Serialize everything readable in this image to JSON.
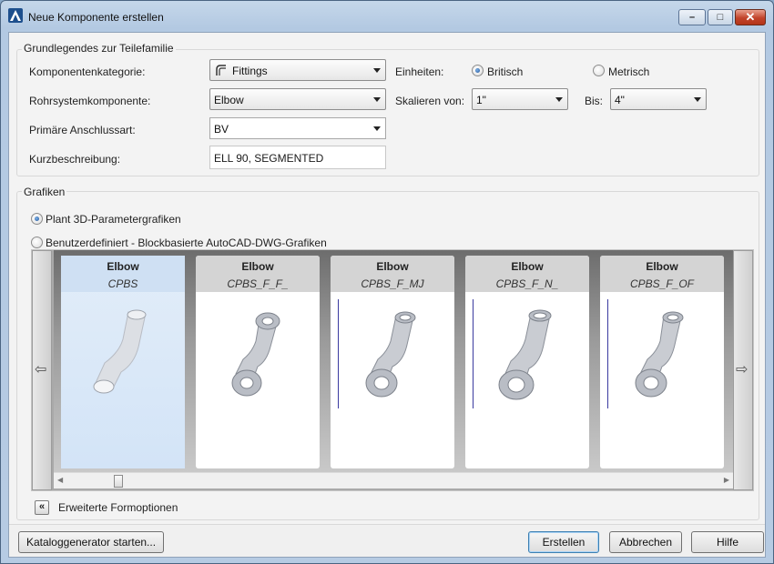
{
  "window": {
    "title": "Neue Komponente erstellen"
  },
  "basics": {
    "legend": "Grundlegendes zur Teilefamilie",
    "category_label": "Komponentenkategorie:",
    "category_value": "Fittings",
    "component_label": "Rohrsystemkomponente:",
    "component_value": "Elbow",
    "connection_label": "Primäre Anschlussart:",
    "connection_value": "BV",
    "short_desc_label": "Kurzbeschreibung:",
    "short_desc_value": "ELL 90, SEGMENTED",
    "units_label": "Einheiten:",
    "unit_imperial": "Britisch",
    "unit_metric": "Metrisch",
    "scale_from_label": "Skalieren von:",
    "scale_from_value": "1\"",
    "scale_to_label": "Bis:",
    "scale_to_value": "4\""
  },
  "graphics": {
    "legend": "Grafiken",
    "option_plant3d": "Plant 3D-Parametergrafiken",
    "option_custom": "Benutzerdefiniert - Blockbasierte AutoCAD-DWG-Grafiken",
    "cards": [
      {
        "title": "Elbow",
        "subtitle": "CPBS"
      },
      {
        "title": "Elbow",
        "subtitle": "CPBS_F_F_"
      },
      {
        "title": "Elbow",
        "subtitle": "CPBS_F_MJ"
      },
      {
        "title": "Elbow",
        "subtitle": "CPBS_F_N_"
      },
      {
        "title": "Elbow",
        "subtitle": "CPBS_F_OF"
      }
    ],
    "advanced_label": "Erweiterte Formoptionen"
  },
  "footer": {
    "catalog_button": "Kataloggenerator starten...",
    "create_button": "Erstellen",
    "cancel_button": "Abbrechen",
    "help_button": "Hilfe"
  }
}
